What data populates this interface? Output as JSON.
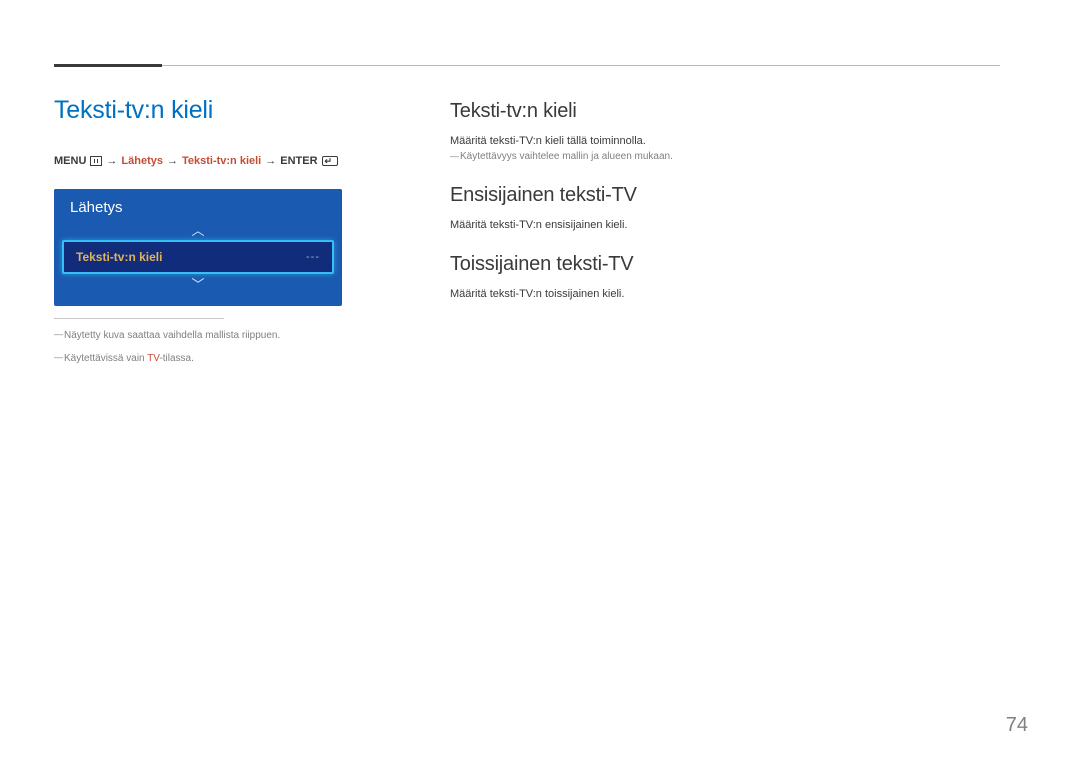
{
  "page_number": "74",
  "left": {
    "main_title": "Teksti-tv:n kieli",
    "breadcrumb": {
      "menu": "MENU",
      "nav1": "Lähetys",
      "nav2": "Teksti-tv:n kieli",
      "enter": "ENTER"
    },
    "panel": {
      "header": "Lähetys",
      "selected_label": "Teksti-tv:n kieli",
      "selected_value": "---"
    },
    "footnote1": "Näytetty kuva saattaa vaihdella mallista riippuen.",
    "footnote2_pre": "Käytettävissä vain ",
    "footnote2_hi": "TV",
    "footnote2_post": "-tilassa."
  },
  "right": {
    "sections": [
      {
        "title": "Teksti-tv:n kieli",
        "body": "Määritä teksti-TV:n kieli tällä toiminnolla.",
        "note": "Käytettävyys vaihtelee mallin ja alueen mukaan."
      },
      {
        "title": "Ensisijainen teksti-TV",
        "body": "Määritä teksti-TV:n ensisijainen kieli."
      },
      {
        "title": "Toissijainen teksti-TV",
        "body": "Määritä teksti-TV:n toissijainen kieli."
      }
    ]
  }
}
